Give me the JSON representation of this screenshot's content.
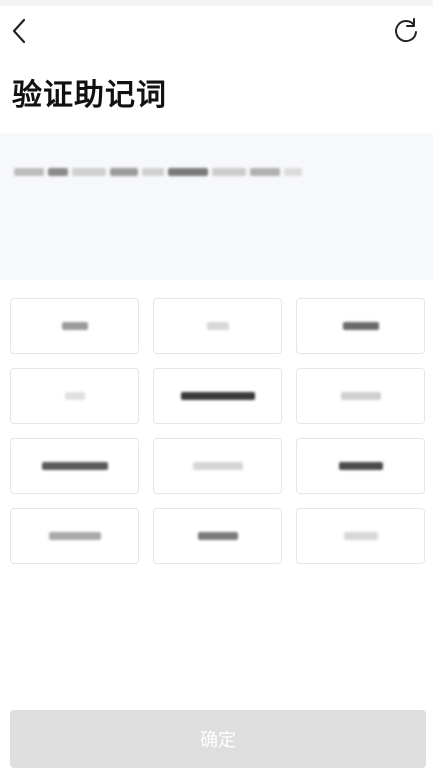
{
  "header": {
    "title": "验证助记词",
    "back_icon": "chevron-left-icon",
    "refresh_icon": "refresh-icon"
  },
  "phrase": {
    "text": ""
  },
  "words": [
    {
      "text": "",
      "tone": "#9a9a9a",
      "w": 26
    },
    {
      "text": "",
      "tone": "#d8d8d8",
      "w": 22
    },
    {
      "text": "",
      "tone": "#6a6a6a",
      "w": 36
    },
    {
      "text": "",
      "tone": "#e0e0e0",
      "w": 20
    },
    {
      "text": "",
      "tone": "#3a3a3a",
      "w": 74
    },
    {
      "text": "",
      "tone": "#cfcfcf",
      "w": 40
    },
    {
      "text": "",
      "tone": "#5a5a5a",
      "w": 66
    },
    {
      "text": "",
      "tone": "#d6d6d6",
      "w": 50
    },
    {
      "text": "",
      "tone": "#4a4a4a",
      "w": 44
    },
    {
      "text": "",
      "tone": "#a8a8a8",
      "w": 52
    },
    {
      "text": "",
      "tone": "#7a7a7a",
      "w": 40
    },
    {
      "text": "",
      "tone": "#d8d8d8",
      "w": 34
    }
  ],
  "footer": {
    "confirm_label": "确定"
  }
}
